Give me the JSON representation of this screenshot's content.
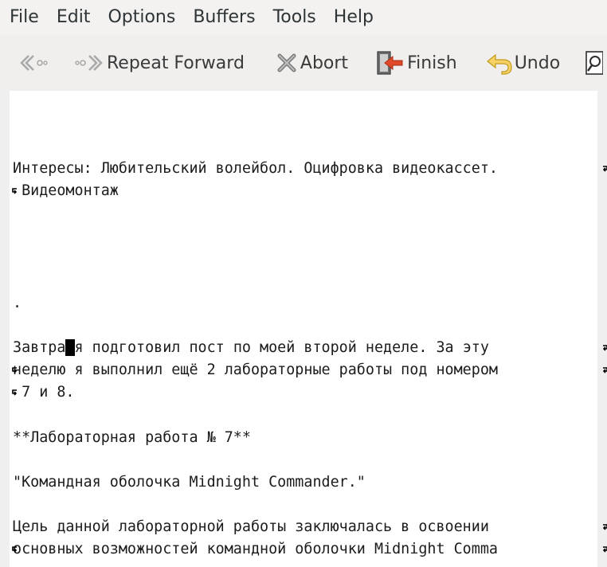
{
  "menu": {
    "file": "File",
    "edit": "Edit",
    "options": "Options",
    "buffers": "Buffers",
    "tools": "Tools",
    "help": "Help"
  },
  "toolbar": {
    "repeat_forward": "Repeat Forward",
    "abort": "Abort",
    "finish": "Finish",
    "undo": "Undo"
  },
  "editor": {
    "lines": [
      "Интересы: Любительский волейбол. Оцифровка видеокассет.",
      " Видеомонтаж",
      ".",
      "Завтра я подготовил пост по моей второй неделе. За эту",
      "неделю я выполнил ещё 2 лабораторные работы под номером",
      " 7 и 8.",
      "**Лабораторная работа № 7**",
      "\"Командная оболочка Midnight Commander.\"",
      "Цель данной лабораторной работы заключалась в освоении",
      "основных возможностей командной оболочки Midnight Comma"
    ],
    "cursor_line": {
      "before": "Завтра",
      "char": " ",
      "after": "я подготовил пост по моей второй неделе. За эту"
    }
  }
}
